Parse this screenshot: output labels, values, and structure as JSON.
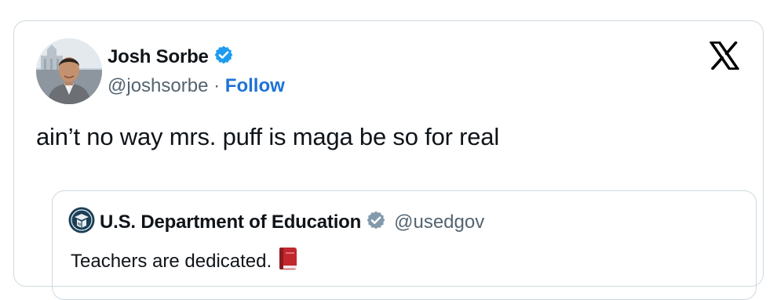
{
  "author": {
    "name": "Josh Sorbe",
    "handle": "@joshsorbe",
    "separator": "·",
    "follow_label": "Follow",
    "verified_icon": "verified-badge-icon",
    "verified_color": "#1d9bf0"
  },
  "platform_icon": "x-logo-icon",
  "tweet_text": "ain’t no way mrs. puff is maga be so for real",
  "quote": {
    "name": "U.S. Department of Education",
    "handle": "@usedgov",
    "avatar_icon": "education-department-logo-icon",
    "verified_icon": "government-verified-badge-icon",
    "verified_color": "#829aab",
    "text": "Teachers are dedicated.",
    "emoji_icon": "red-book-icon"
  },
  "colors": {
    "follow": "#1d73d6",
    "secondary_text": "#536471",
    "border": "#cfd9de"
  }
}
